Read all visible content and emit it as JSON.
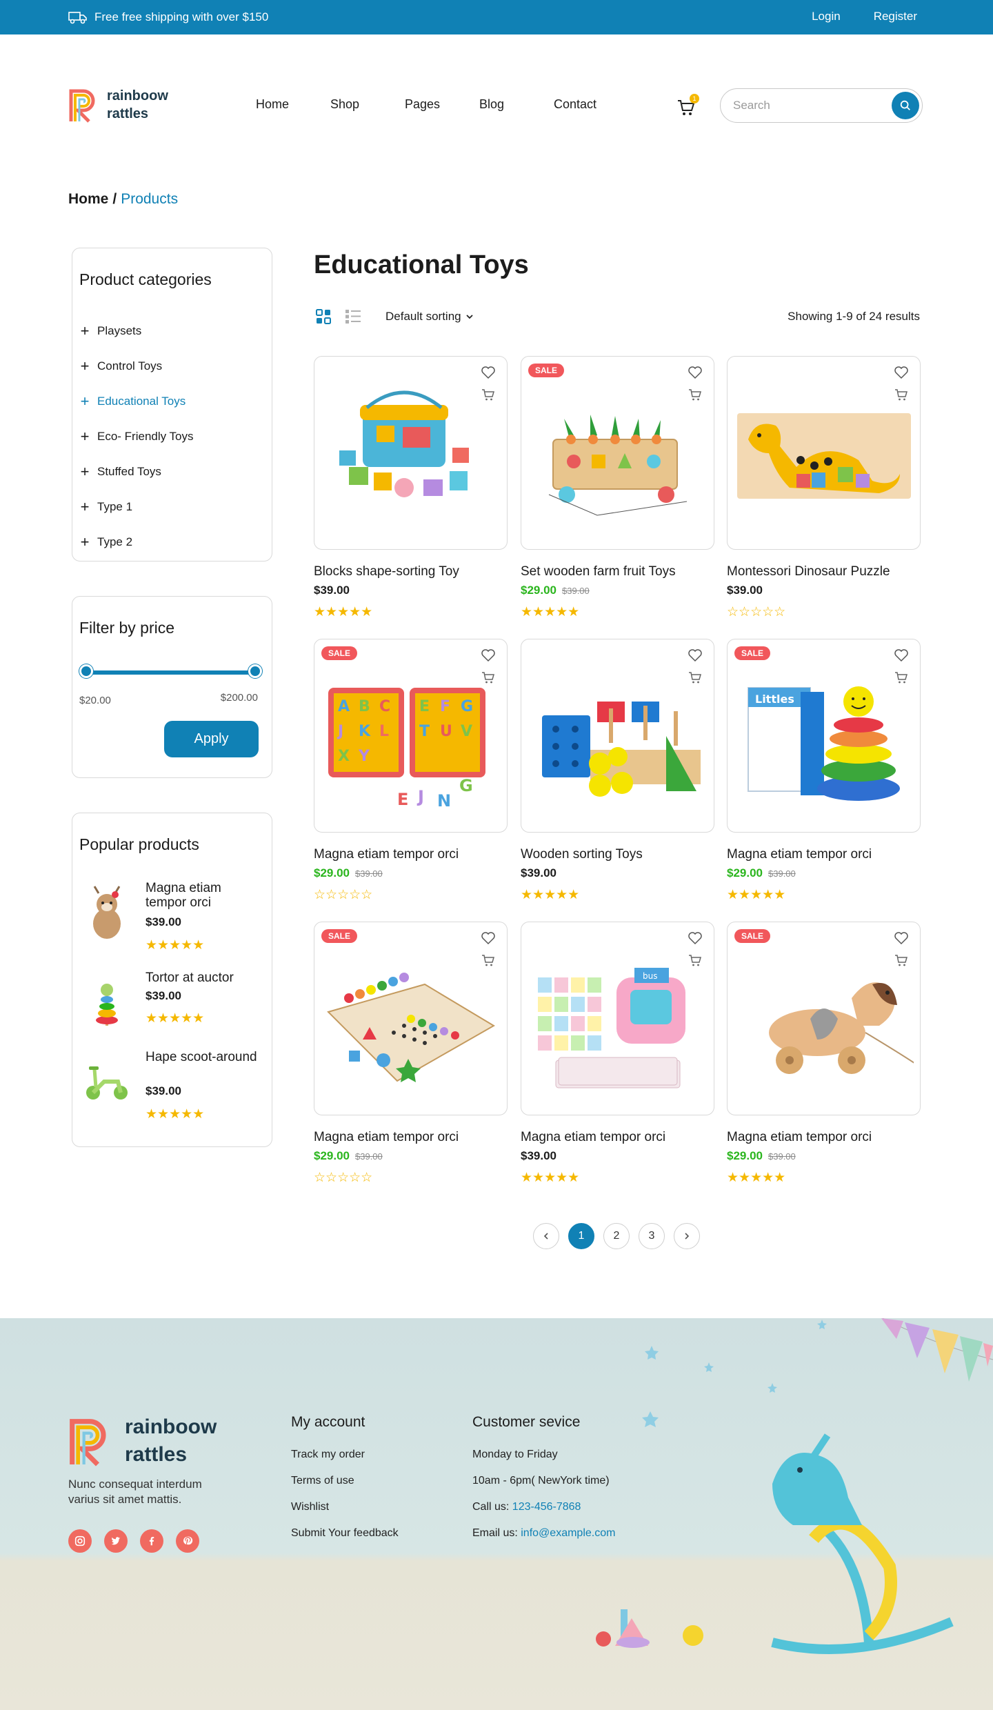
{
  "topbar": {
    "shipping_text": "Free  free shipping with over $150",
    "login": "Login",
    "register": "Register"
  },
  "header": {
    "logo_line1": "rainboow",
    "logo_line2": "rattles",
    "nav": [
      "Home",
      "Shop",
      "Pages",
      "Blog",
      "Contact"
    ],
    "cart_count": "1",
    "search_placeholder": "Search"
  },
  "breadcrumb": {
    "home": "Home",
    "separator": "/",
    "current": "Products"
  },
  "sidebar": {
    "categories_title": "Product categories",
    "categories": [
      {
        "label": "Playsets",
        "active": false
      },
      {
        "label": "Control Toys",
        "active": false
      },
      {
        "label": "Educational Toys",
        "active": true
      },
      {
        "label": "Eco- Friendly Toys",
        "active": false
      },
      {
        "label": "Stuffed Toys",
        "active": false
      },
      {
        "label": "Type 1",
        "active": false
      },
      {
        "label": "Type 2",
        "active": false
      }
    ],
    "price_title": "Filter by price",
    "price_min": "$20.00",
    "price_max": "$200.00",
    "apply_label": "Apply",
    "popular_title": "Popular products",
    "popular": [
      {
        "name": "Magna etiam tempor orci",
        "price": "$39.00",
        "rating": 5
      },
      {
        "name": "Tortor at auctor",
        "price": "$39.00",
        "rating": 5
      },
      {
        "name": "Hape scoot-around",
        "price": "$39.00",
        "rating": 5
      }
    ]
  },
  "main": {
    "title": "Educational Toys",
    "sorting": "Default sorting",
    "results": "Showing 1-9 of 24 results",
    "sale_label": "SALE",
    "products": [
      {
        "name": "Blocks shape-sorting Toy",
        "price": "$39.00",
        "old_price": "",
        "sale": false,
        "rating": 5,
        "image": "shape-sorter-bucket"
      },
      {
        "name": "Set wooden farm fruit Toys",
        "price": "$29.00",
        "old_price": "$39.00",
        "sale": true,
        "rating": 5,
        "image": "wooden-carrot-cart"
      },
      {
        "name": "Montessori Dinosaur Puzzle",
        "price": "$39.00",
        "old_price": "",
        "sale": false,
        "rating": 0,
        "image": "dinosaur-puzzle"
      },
      {
        "name": "Magna etiam tempor orci",
        "price": "$29.00",
        "old_price": "$39.00",
        "sale": true,
        "rating": 0,
        "image": "alphabet-puzzle"
      },
      {
        "name": "Wooden sorting Toys",
        "price": "$39.00",
        "old_price": "",
        "sale": false,
        "rating": 5,
        "image": "peg-sorting-board"
      },
      {
        "name": "Magna etiam tempor orci",
        "price": "$29.00",
        "old_price": "$39.00",
        "sale": true,
        "rating": 5,
        "image": "stacking-rings"
      },
      {
        "name": "Magna etiam tempor orci",
        "price": "$29.00",
        "old_price": "$39.00",
        "sale": true,
        "rating": 0,
        "image": "counting-pegboard"
      },
      {
        "name": "Magna etiam tempor orci",
        "price": "$39.00",
        "old_price": "",
        "sale": false,
        "rating": 5,
        "image": "talking-flash-cards"
      },
      {
        "name": "Magna etiam tempor orci",
        "price": "$29.00",
        "old_price": "$39.00",
        "sale": true,
        "rating": 5,
        "image": "wooden-pull-dog"
      }
    ],
    "pages": [
      "1",
      "2",
      "3"
    ],
    "current_page": "1"
  },
  "footer": {
    "logo_line1": "rainboow",
    "logo_line2": "rattles",
    "tagline": "Nunc consequat interdum varius sit amet mattis.",
    "socials": [
      "instagram-icon",
      "twitter-icon",
      "facebook-icon",
      "pinterest-icon"
    ],
    "account_title": "My account",
    "account_links": [
      "Track my order",
      "Terms of use",
      "Wishlist",
      "Submit Your feedback"
    ],
    "service_title": "Customer sevice",
    "service_hours_days": "Monday to Friday",
    "service_hours_time": "10am - 6pm( NewYork time)",
    "call_label": "Call us: ",
    "phone": "123-456-7868",
    "email_label": "Email us: ",
    "email": "info@example.com"
  },
  "colors": {
    "brand": "#1081b5",
    "sale": "#f1575b",
    "price_sale": "#2ab51d",
    "star": "#f5b800"
  }
}
